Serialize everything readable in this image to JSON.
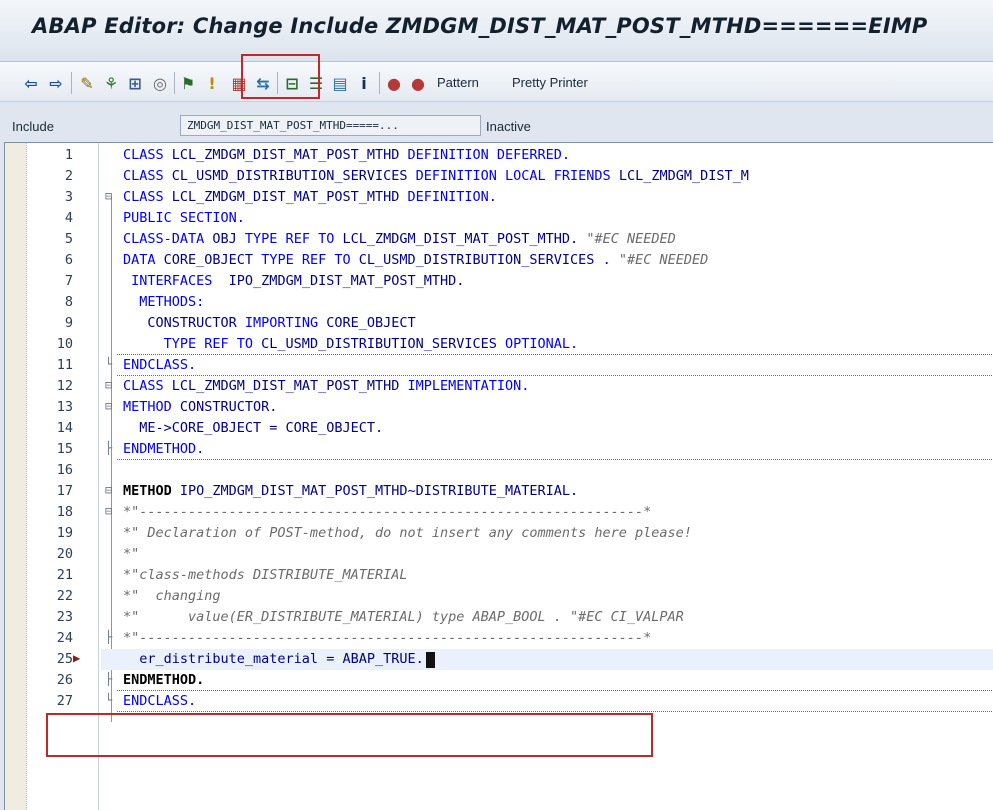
{
  "window": {
    "title": "ABAP Editor: Change Include ZMDGM_DIST_MAT_POST_MTHD======EIMP"
  },
  "toolbar": {
    "icons": [
      {
        "name": "back-arrow-icon",
        "glyph": "⇦",
        "color": "#1a4fa0"
      },
      {
        "name": "forward-arrow-icon",
        "glyph": "⇨",
        "color": "#1a4fa0"
      },
      {
        "name": "display-change-icon",
        "glyph": "✎",
        "color": "#8a6a00"
      },
      {
        "name": "active-inactive-icon",
        "glyph": "⚘",
        "color": "#2d7a2d"
      },
      {
        "name": "other-object-icon",
        "glyph": "⊞",
        "color": "#3a5a8a"
      },
      {
        "name": "check-icon",
        "glyph": "◎",
        "color": "#6a6a6a"
      },
      {
        "name": "activate-icon",
        "glyph": "⚑",
        "color": "#2d6a2d"
      },
      {
        "name": "test-icon",
        "glyph": "!",
        "color": "#c28a00"
      },
      {
        "name": "where-used-icon",
        "glyph": "▦",
        "color": "#b23a3a"
      },
      {
        "name": "navigate-icon",
        "glyph": "⇆",
        "color": "#2a6fa8"
      },
      {
        "name": "object-list-icon",
        "glyph": "⊟",
        "color": "#2d6a2d"
      },
      {
        "name": "display-object-list-icon",
        "glyph": "☰",
        "color": "#2d6a2d"
      },
      {
        "name": "navigation-window-icon",
        "glyph": "▤",
        "color": "#2a6fa8"
      },
      {
        "name": "info-icon",
        "glyph": "i",
        "color": "#13305a"
      },
      {
        "name": "set-breakpoint-icon",
        "glyph": "●",
        "color": "#b23a3a"
      },
      {
        "name": "set-external-breakpoint-icon",
        "glyph": "●",
        "color": "#b23a3a"
      }
    ],
    "pattern_label": "Pattern",
    "pretty_printer_label": "Pretty Printer"
  },
  "header": {
    "include_label": "Include",
    "include_name": "ZMDGM_DIST_MAT_POST_MTHD=====...",
    "status": "Inactive"
  },
  "editor": {
    "lines": [
      {
        "n": "1",
        "fold": "",
        "segs": [
          [
            "kw",
            "CLASS "
          ],
          [
            "id",
            "LCL_ZMDGM_DIST_MAT_POST_MTHD "
          ],
          [
            "kw",
            "DEFINITION DEFERRED."
          ]
        ]
      },
      {
        "n": "2",
        "fold": "",
        "segs": [
          [
            "kw",
            "CLASS "
          ],
          [
            "id",
            "CL_USMD_DISTRIBUTION_SERVICES "
          ],
          [
            "kw",
            "DEFINITION LOCAL FRIENDS "
          ],
          [
            "id",
            "LCL_ZMDGM_DIST_M"
          ]
        ]
      },
      {
        "n": "3",
        "fold": "⊟",
        "segs": [
          [
            "kw",
            "CLASS "
          ],
          [
            "id",
            "LCL_ZMDGM_DIST_MAT_POST_MTHD "
          ],
          [
            "kw",
            "DEFINITION."
          ]
        ]
      },
      {
        "n": "4",
        "fold": "",
        "segs": [
          [
            "kw",
            "PUBLIC SECTION."
          ]
        ]
      },
      {
        "n": "5",
        "fold": "",
        "segs": [
          [
            "kw",
            "CLASS-DATA "
          ],
          [
            "id",
            "OBJ "
          ],
          [
            "kw",
            "TYPE REF TO "
          ],
          [
            "id",
            "LCL_ZMDGM_DIST_MAT_POST_MTHD. "
          ],
          [
            "cmt",
            "\"#EC NEEDED"
          ]
        ]
      },
      {
        "n": "6",
        "fold": "",
        "segs": [
          [
            "kw",
            "DATA "
          ],
          [
            "id",
            "CORE_OBJECT "
          ],
          [
            "kw",
            "TYPE REF TO "
          ],
          [
            "id",
            "CL_USMD_DISTRIBUTION_SERVICES "
          ],
          [
            "kw",
            ". "
          ],
          [
            "cmt",
            "\"#EC NEEDED"
          ]
        ]
      },
      {
        "n": "7",
        "fold": "",
        "segs": [
          [
            "kw",
            " INTERFACES  "
          ],
          [
            "id",
            "IPO_ZMDGM_DIST_MAT_POST_MTHD."
          ]
        ]
      },
      {
        "n": "8",
        "fold": "",
        "segs": [
          [
            "kw",
            "  METHODS:"
          ]
        ]
      },
      {
        "n": "9",
        "fold": "",
        "segs": [
          [
            "id",
            "   CONSTRUCTOR "
          ],
          [
            "kw",
            "IMPORTING "
          ],
          [
            "id",
            "CORE_OBJECT"
          ]
        ]
      },
      {
        "n": "10",
        "fold": "",
        "segs": [
          [
            "kw",
            "     TYPE REF TO "
          ],
          [
            "id",
            "CL_USMD_DISTRIBUTION_SERVICES "
          ],
          [
            "kw",
            "OPTIONAL."
          ]
        ]
      },
      {
        "n": "11",
        "fold": "└",
        "segs": [
          [
            "kw",
            "ENDCLASS."
          ]
        ]
      },
      {
        "n": "12",
        "fold": "⊟",
        "segs": [
          [
            "kw",
            "CLASS "
          ],
          [
            "id",
            "LCL_ZMDGM_DIST_MAT_POST_MTHD "
          ],
          [
            "kw",
            "IMPLEMENTATION."
          ]
        ]
      },
      {
        "n": "13",
        "fold": "⊟",
        "segs": [
          [
            "kw",
            "METHOD "
          ],
          [
            "id",
            "CONSTRUCTOR."
          ]
        ]
      },
      {
        "n": "14",
        "fold": "",
        "segs": [
          [
            "id",
            "  ME->CORE_OBJECT = CORE_OBJECT."
          ]
        ]
      },
      {
        "n": "15",
        "fold": "├",
        "segs": [
          [
            "kw",
            "ENDMETHOD."
          ]
        ]
      },
      {
        "n": "16",
        "fold": "",
        "segs": []
      },
      {
        "n": "17",
        "fold": "⊟",
        "segs": [
          [
            "bold",
            "METHOD "
          ],
          [
            "id",
            "IPO_ZMDGM_DIST_MAT_POST_MTHD~DISTRIBUTE_MATERIAL."
          ]
        ]
      },
      {
        "n": "18",
        "fold": "⊟",
        "segs": [
          [
            "cmt",
            "*\"--------------------------------------------------------------*"
          ]
        ]
      },
      {
        "n": "19",
        "fold": "",
        "segs": [
          [
            "cmt",
            "*\" Declaration of POST-method, do not insert any comments here please!"
          ]
        ]
      },
      {
        "n": "20",
        "fold": "",
        "segs": [
          [
            "cmt",
            "*\""
          ]
        ]
      },
      {
        "n": "21",
        "fold": "",
        "segs": [
          [
            "cmt",
            "*\"class-methods DISTRIBUTE_MATERIAL"
          ]
        ]
      },
      {
        "n": "22",
        "fold": "",
        "segs": [
          [
            "cmt",
            "*\"  changing"
          ]
        ]
      },
      {
        "n": "23",
        "fold": "",
        "segs": [
          [
            "cmt",
            "*\"      value(ER_DISTRIBUTE_MATERIAL) type ABAP_BOOL . \"#EC CI_VALPAR"
          ]
        ]
      },
      {
        "n": "24",
        "fold": "├",
        "segs": [
          [
            "cmt",
            "*\"--------------------------------------------------------------*"
          ]
        ]
      },
      {
        "n": "25",
        "fold": "",
        "segs": [
          [
            "id",
            "  er_distribute_material = ABAP_TRUE."
          ]
        ],
        "active": true
      },
      {
        "n": "26",
        "fold": "├",
        "segs": [
          [
            "bold",
            "ENDMETHOD."
          ]
        ]
      },
      {
        "n": "27",
        "fold": "└",
        "segs": [
          [
            "kw",
            "ENDCLASS."
          ]
        ]
      }
    ]
  }
}
